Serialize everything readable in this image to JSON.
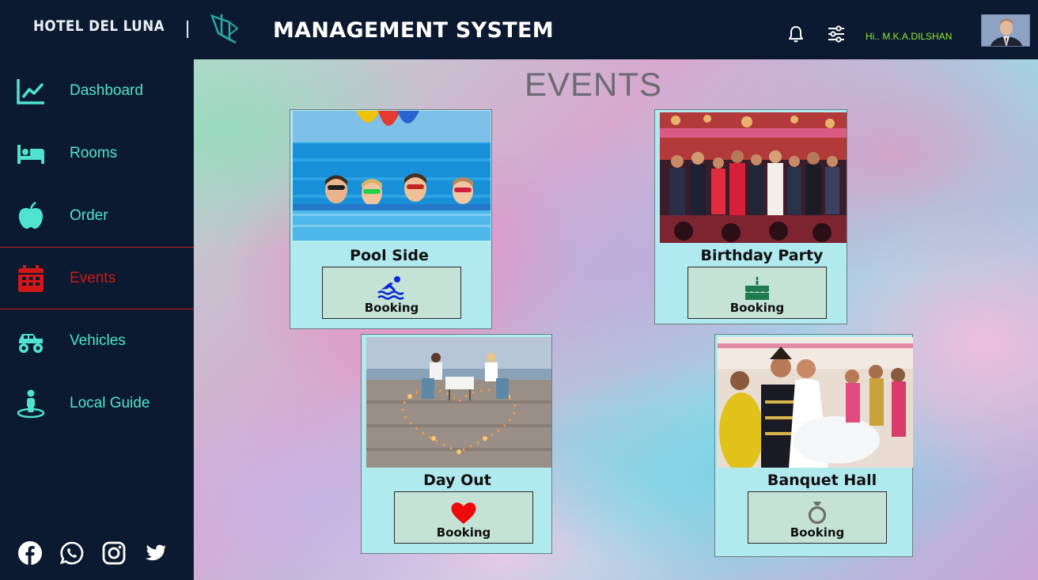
{
  "header": {
    "brand": "HOTEL DEL LUNA",
    "title": "MANAGEMENT SYSTEM",
    "greeting": "Hi.. M.K.A.DILSHAN"
  },
  "sidebar": {
    "items": [
      {
        "label": "Dashboard",
        "icon": "chart-line-icon"
      },
      {
        "label": "Rooms",
        "icon": "bed-icon"
      },
      {
        "label": "Order",
        "icon": "apple-icon"
      },
      {
        "label": "Events",
        "icon": "calendar-icon",
        "active": true
      },
      {
        "label": "Vehicles",
        "icon": "monster-truck-icon"
      },
      {
        "label": "Local Guide",
        "icon": "street-view-icon"
      }
    ],
    "socials": [
      "facebook-icon",
      "whatsapp-icon",
      "instagram-icon",
      "twitter-icon"
    ]
  },
  "main": {
    "title": "EVENTS",
    "cards": [
      {
        "name": "Pool Side",
        "button": "Booking",
        "icon": "swimmer-icon"
      },
      {
        "name": "Birthday Party",
        "button": "Booking",
        "icon": "birthday-cake-icon"
      },
      {
        "name": "Day Out",
        "button": "Booking",
        "icon": "heart-icon"
      },
      {
        "name": "Banquet Hall",
        "button": "Booking",
        "icon": "ring-icon"
      }
    ]
  },
  "colors": {
    "sidebar_bg": "#0b1a30",
    "nav_text": "#4fe3cf",
    "active": "#d31616",
    "greeting": "#8ee832",
    "card_bg": "#b0e9ee",
    "button_bg": "#c4e3d6"
  }
}
